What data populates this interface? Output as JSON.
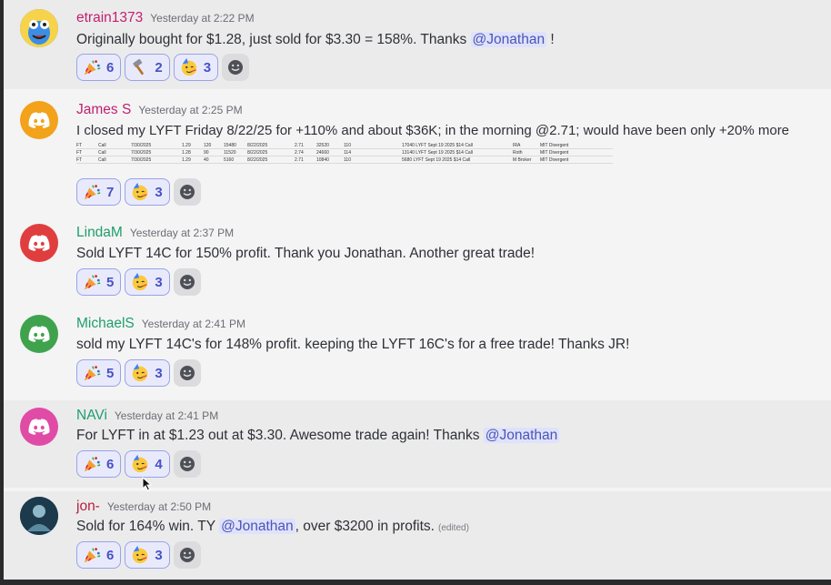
{
  "messages": [
    {
      "username": "etrain1373",
      "username_color": "#c0216e",
      "timestamp": "Yesterday at 2:22 PM",
      "text_before": "Originally bought for $1.28, just sold for $3.30 = 158%. Thanks ",
      "mention": "@Jonathan",
      "text_after": " !",
      "reactions": [
        {
          "emoji": "party-popper",
          "count": "6"
        },
        {
          "emoji": "hammer",
          "count": "2"
        },
        {
          "emoji": "partying-face",
          "count": "3"
        }
      ]
    },
    {
      "username": "James S",
      "username_color": "#c0216e",
      "timestamp": "Yesterday at 2:25 PM",
      "text": "I closed my LYFT Friday 8/22/25 for +110% and about $36K; in the morning @2.71; would have been only +20% more",
      "table_rows": [
        [
          "FT",
          "Call",
          "7/30/2025",
          "1.29",
          "120",
          "15480",
          "8/22/2025",
          "2.71",
          "32520",
          "110",
          "17040 LYFT Sept 19 2025 $14 Call",
          "IRA",
          "MIT Divergent"
        ],
        [
          "FT",
          "Call",
          "7/30/2025",
          "1.28",
          "90",
          "11520",
          "8/22/2025",
          "2.74",
          "24660",
          "114",
          "13140 LYFT Sept 19 2025 $14 Call",
          "Roth",
          "MIT Divergent"
        ],
        [
          "FT",
          "Call",
          "7/30/2025",
          "1.29",
          "40",
          "5160",
          "8/22/2025",
          "2.71",
          "10840",
          "110",
          "5680 LYFT Sept 19 2025 $14 Call",
          "M Broker",
          "MIT Divergent"
        ]
      ],
      "reactions": [
        {
          "emoji": "party-popper",
          "count": "7"
        },
        {
          "emoji": "partying-face",
          "count": "3"
        }
      ]
    },
    {
      "username": "LindaM",
      "username_color": "#1f9e6b",
      "timestamp": "Yesterday at 2:37 PM",
      "text": "Sold LYFT 14C for 150% profit.  Thank you Jonathan.  Another great trade!",
      "reactions": [
        {
          "emoji": "party-popper",
          "count": "5"
        },
        {
          "emoji": "partying-face",
          "count": "3"
        }
      ]
    },
    {
      "username": "MichaelS",
      "username_color": "#1f9e6b",
      "timestamp": "Yesterday at 2:41 PM",
      "text": "sold my LYFT 14C's for 148% profit.  keeping the LYFT 16C's for a free trade! Thanks JR!",
      "reactions": [
        {
          "emoji": "party-popper",
          "count": "5"
        },
        {
          "emoji": "partying-face",
          "count": "3"
        }
      ]
    },
    {
      "username": "NAVi",
      "username_color": "#1f9e6b",
      "timestamp": "Yesterday at 2:41 PM",
      "text_before": "For LYFT in at $1.23 out at $3.30.  Awesome trade again!  Thanks ",
      "mention": "@Jonathan",
      "reactions": [
        {
          "emoji": "party-popper",
          "count": "6"
        },
        {
          "emoji": "partying-face",
          "count": "4"
        }
      ]
    },
    {
      "username": "jon-",
      "username_color": "#b8203a",
      "timestamp": "Yesterday at 2:50 PM",
      "text_before": "Sold for 164% win. TY ",
      "mention": "@Jonathan",
      "text_after": ", over $3200 in profits.",
      "edited": "(edited)",
      "reactions": [
        {
          "emoji": "party-popper",
          "count": "6"
        },
        {
          "emoji": "partying-face",
          "count": "3"
        }
      ]
    }
  ],
  "colors": {
    "avatar_etrain": "#3a8ee6",
    "avatar_james": "#f2a21b",
    "avatar_linda": "#e03e3e",
    "avatar_michael": "#3fa34d",
    "avatar_navi": "#e04ba6",
    "avatar_jon": "#1c3a4c",
    "mention_bg": "#dfe2fb",
    "reaction_border": "#9aa2e6"
  }
}
